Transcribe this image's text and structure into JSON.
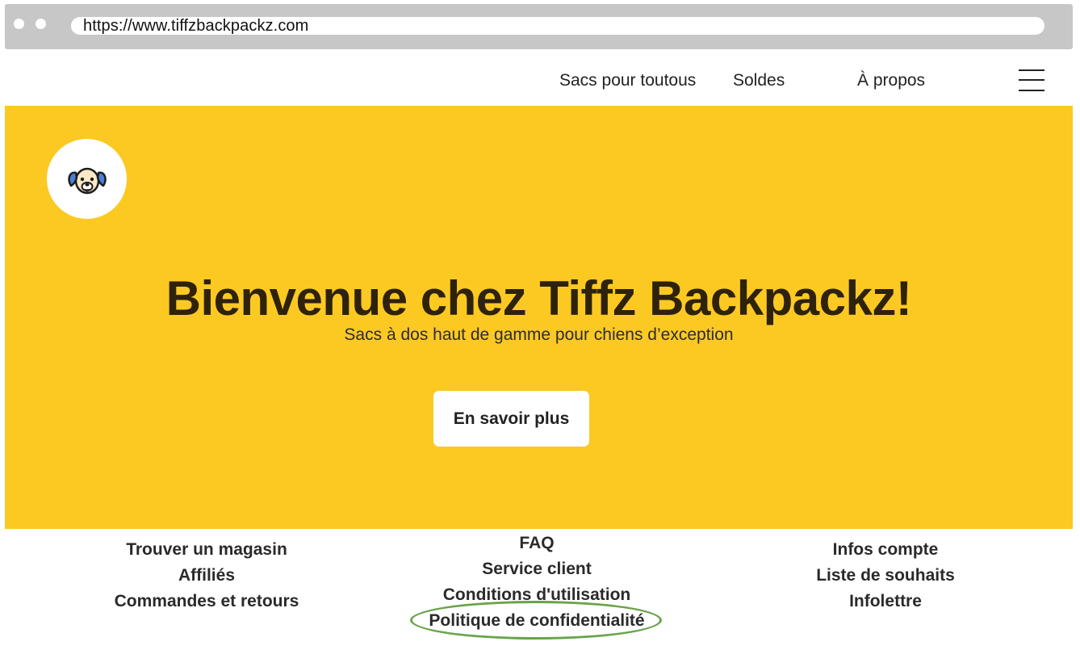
{
  "browser": {
    "url": "https://www.tiffzbackpackz.com"
  },
  "nav": {
    "links": [
      {
        "label": "Sacs pour toutous"
      },
      {
        "label": "Soldes"
      },
      {
        "label": "À propos"
      }
    ],
    "menu_icon": "hamburger-menu-icon"
  },
  "hero": {
    "logo_icon": "dog-face-icon",
    "title": "Bienvenue chez Tiffz Backpackz!",
    "subtitle": "Sacs à dos haut de gamme pour chiens d’exception",
    "cta_label": "En savoir plus",
    "background_color": "#fcc923"
  },
  "footer": {
    "col1": [
      "Trouver un magasin",
      "Affiliés",
      "Commandes et retours"
    ],
    "col2": [
      "FAQ",
      "Service client",
      "Conditions d'utilisation",
      "Politique de confidentialité"
    ],
    "col3": [
      "Infos compte",
      "Liste de souhaits",
      "Infolettre"
    ],
    "highlight_color": "#6aa34a"
  }
}
